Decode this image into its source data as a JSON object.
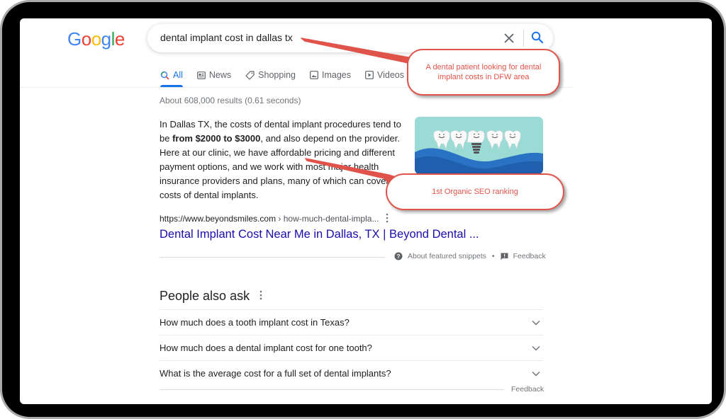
{
  "google_logo": {
    "letters": [
      "G",
      "o",
      "o",
      "g",
      "l",
      "e"
    ],
    "colors": [
      "#4285f4",
      "#ea4335",
      "#fbbc05",
      "#4285f4",
      "#34a853",
      "#ea4335"
    ]
  },
  "search": {
    "query": "dental implant cost in dallas tx",
    "clear_icon": "close-icon",
    "search_icon": "search-icon"
  },
  "tabs": [
    {
      "label": "All",
      "icon": "search-icon",
      "active": true
    },
    {
      "label": "News",
      "icon": "news-icon",
      "active": false
    },
    {
      "label": "Shopping",
      "icon": "tag-icon",
      "active": false
    },
    {
      "label": "Images",
      "icon": "image-icon",
      "active": false
    },
    {
      "label": "Videos",
      "icon": "play-icon",
      "active": false
    }
  ],
  "result_stats": "About 608,000 results (0.61 seconds)",
  "featured_snippet": {
    "text_before": "In Dallas TX, the costs of dental implant procedures tend to be ",
    "text_bold": "from $2000 to $3000",
    "text_after": ", and also depend on the provider. Here at our clinic, we have affordable pricing and different payment options, and we work with most major health insurance providers and plans, many of which can cover the costs of dental implants.",
    "image_alt": "Cartoon smiling teeth with a dental implant",
    "url_domain": "https://www.beyondsmiles.com",
    "url_path": " › how-much-dental-impla...",
    "title": "Dental Implant Cost Near Me in Dallas, TX | Beyond Dental ...",
    "about_label": "About featured snippets",
    "separator": "•",
    "feedback_label": "Feedback"
  },
  "people_also_ask": {
    "title": "People also ask",
    "questions": [
      "How much does a tooth implant cost in Texas?",
      "How much does a dental implant cost for one tooth?",
      "What is the average cost for a full set of dental implants?"
    ],
    "feedback_label": "Feedback"
  },
  "annotations": {
    "callout_search": "A dental patient looking for dental implant costs in DFW area",
    "callout_ranking": "1st Organic SEO ranking",
    "color": "#e0534a"
  }
}
